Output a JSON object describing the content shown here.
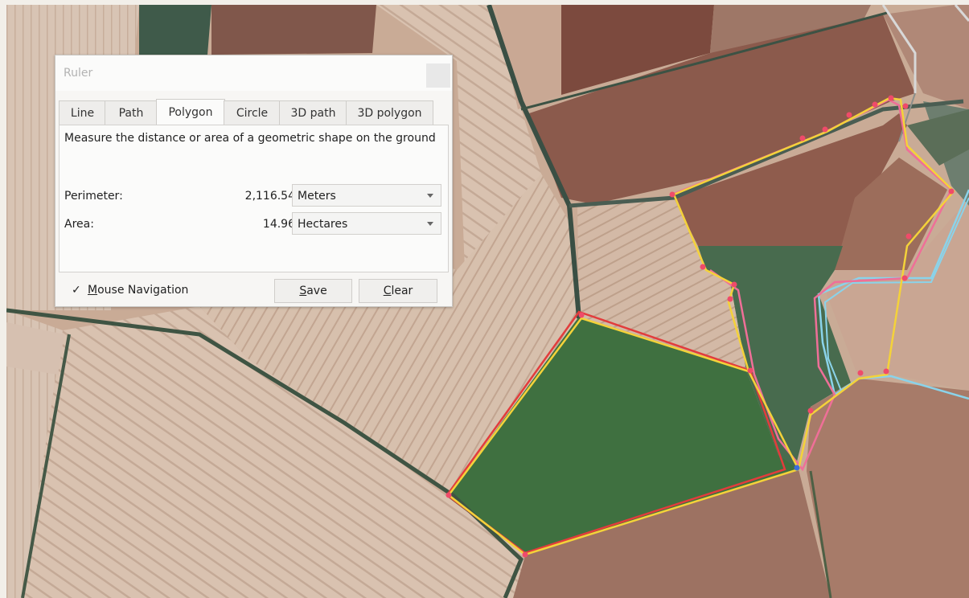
{
  "map": {
    "polygons": {
      "yellow_color": "#f4d23a",
      "pink_color": "#ef6f98",
      "red_color": "#e23c3c",
      "cyan_color": "#8ad3ea",
      "vertex_color": "#ef4b6a"
    }
  },
  "ruler": {
    "title": "Ruler",
    "tabs": [
      {
        "label": "Line",
        "active": false
      },
      {
        "label": "Path",
        "active": false
      },
      {
        "label": "Polygon",
        "active": true
      },
      {
        "label": "Circle",
        "active": false
      },
      {
        "label": "3D path",
        "active": false
      },
      {
        "label": "3D polygon",
        "active": false
      }
    ],
    "description": "Measure the distance or area of a geometric shape on the ground",
    "perimeter": {
      "label": "Perimeter:",
      "value": "2,116.54",
      "unit": "Meters"
    },
    "area": {
      "label": "Area:",
      "value": "14.96",
      "unit": "Hectares"
    },
    "mouse_navigation": {
      "checked": true,
      "label_first": "M",
      "label_rest": "ouse Navigation"
    },
    "save": {
      "first": "S",
      "rest": "ave"
    },
    "clear": {
      "first": "C",
      "rest": "lear"
    }
  }
}
